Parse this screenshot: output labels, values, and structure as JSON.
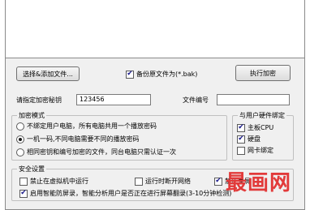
{
  "toolbar": {
    "select_label": "选择&添加文件...",
    "backup_label": "备份原文件为(*.bak)",
    "backup_checked": true,
    "execute_label": "执行加密"
  },
  "fields": {
    "password_label": "请指定加密秘钥",
    "password_value": "123456",
    "file_no_label": "文件编号",
    "file_no_value": ""
  },
  "encrypt_mode": {
    "title": "加密模式",
    "options": [
      {
        "label": "不绑定用户电脑，所有电脑共用一个播放密码",
        "selected": false
      },
      {
        "label": "一机一码,不同电脑需要不同的播放密码",
        "selected": true
      },
      {
        "label": "相同密钥和编号加密的文件，同台电脑只需认证一次",
        "selected": false
      }
    ]
  },
  "hardware_bind": {
    "title": "与用户硬件绑定",
    "items": [
      {
        "label": "主板CPU",
        "checked": true
      },
      {
        "label": "硬盘",
        "checked": true
      },
      {
        "label": "网卡绑定",
        "checked": false
      }
    ]
  },
  "security": {
    "title": "安全设置",
    "no_vm_label": "禁止在虚拟机中运行",
    "no_vm_checked": false,
    "no_network_label": "运行时断开网络",
    "no_network_checked": false,
    "extra_label": "禁止录屏",
    "extra_checked": true,
    "smart_label": "启用智能防屏录，智能分析用户是否正在进行屏幕翻录(3-10分钟检测)",
    "smart_checked": true
  },
  "watermark_text": "最画网",
  "colors": {
    "watermark": "#e23a3a",
    "check_mark": "#1a1a8a"
  }
}
